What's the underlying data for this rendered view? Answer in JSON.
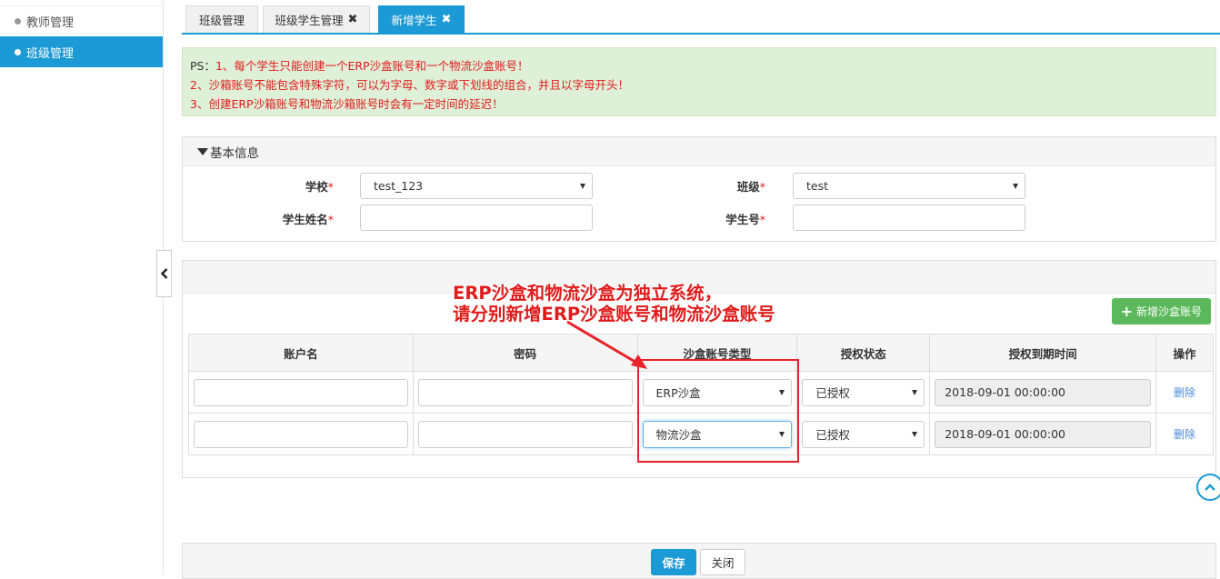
{
  "sidebar": {
    "items": [
      {
        "label": "教师管理"
      },
      {
        "label": "班级管理"
      }
    ]
  },
  "tabs": [
    {
      "label": "班级管理"
    },
    {
      "label": "班级学生管理"
    },
    {
      "label": "新增学生"
    }
  ],
  "notice": {
    "prefix": "PS：",
    "line1": "1、每个学生只能创建一个ERP沙盒账号和一个物流沙盒账号！",
    "line2": "2、沙箱账号不能包含特殊字符，可以为字母、数字或下划线的组合，并且以字母开头！",
    "line3": "3、创建ERP沙箱账号和物流沙箱账号时会有一定时间的延迟！"
  },
  "basic_info": {
    "title": "基本信息",
    "school_label": "学校",
    "school_value": "test_123",
    "class_label": "班级",
    "class_value": "test",
    "name_label": "学生姓名",
    "name_value": "",
    "number_label": "学生号",
    "number_value": "",
    "required_mark": "*"
  },
  "accounts": {
    "add_button": "新增沙盒账号",
    "headers": [
      "账户名",
      "密码",
      "沙盒账号类型",
      "授权状态",
      "授权到期时间",
      "操作"
    ],
    "rows": [
      {
        "account": "",
        "password": "",
        "type": "ERP沙盒",
        "status": "已授权",
        "expiry": "2018-09-01 00:00:00",
        "action": "删除"
      },
      {
        "account": "",
        "password": "",
        "type": "物流沙盒",
        "status": "已授权",
        "expiry": "2018-09-01 00:00:00",
        "action": "删除"
      }
    ]
  },
  "annotation": {
    "line1": "ERP沙盒和物流沙盒为独立系统，",
    "line2": "请分别新增ERP沙盒账号和物流沙盒账号",
    "color": "#e01b1b"
  },
  "footer": {
    "save_label": "保存",
    "close_label": "关闭"
  },
  "colors": {
    "primary": "#1b9ad6",
    "success": "#5cb85c",
    "notice_bg": "#dff0d8",
    "danger": "#e01b1b"
  }
}
